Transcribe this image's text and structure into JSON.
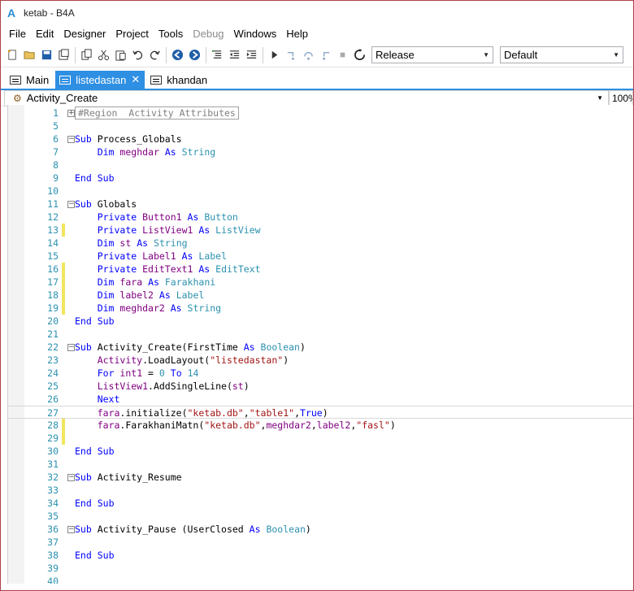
{
  "window": {
    "title": "ketab - B4A"
  },
  "menu": [
    "File",
    "Edit",
    "Designer",
    "Project",
    "Tools",
    "Debug",
    "Windows",
    "Help"
  ],
  "toolbar": {
    "build_config": "Release",
    "device_config": "Default"
  },
  "tabs": [
    {
      "label": "Main",
      "active": false
    },
    {
      "label": "listedastan",
      "active": true,
      "close": "✕"
    },
    {
      "label": "khandan",
      "active": false
    }
  ],
  "subbar": {
    "module": "Activity_Create",
    "zoom": "100%"
  },
  "code_lines": [
    {
      "n": "1",
      "t": "#Region  Activity Attributes"
    },
    {
      "n": "5",
      "t": ""
    },
    {
      "n": "6",
      "t": "Sub Process_Globals"
    },
    {
      "n": "7",
      "t": "    Dim meghdar As String"
    },
    {
      "n": "8",
      "t": ""
    },
    {
      "n": "9",
      "t": "End Sub"
    },
    {
      "n": "10",
      "t": ""
    },
    {
      "n": "11",
      "t": "Sub Globals"
    },
    {
      "n": "12",
      "t": "    Private Button1 As Button"
    },
    {
      "n": "13",
      "t": "    Private ListView1 As ListView"
    },
    {
      "n": "14",
      "t": "    Dim st As String"
    },
    {
      "n": "15",
      "t": "    Private Label1 As Label"
    },
    {
      "n": "16",
      "t": "    Private EditText1 As EditText"
    },
    {
      "n": "17",
      "t": "    Dim fara As Farakhani"
    },
    {
      "n": "18",
      "t": "    Dim label2 As Label"
    },
    {
      "n": "19",
      "t": "    Dim meghdar2 As String"
    },
    {
      "n": "20",
      "t": "End Sub"
    },
    {
      "n": "21",
      "t": ""
    },
    {
      "n": "22",
      "t": "Sub Activity_Create(FirstTime As Boolean)"
    },
    {
      "n": "23",
      "t": "    Activity.LoadLayout(\"listedastan\")"
    },
    {
      "n": "24",
      "t": "    For int1 = 0 To 14"
    },
    {
      "n": "25",
      "t": "    ListView1.AddSingleLine(st)"
    },
    {
      "n": "26",
      "t": "    Next"
    },
    {
      "n": "27",
      "t": "    fara.initialize(\"ketab.db\",\"table1\",True)"
    },
    {
      "n": "28",
      "t": "    fara.FarakhaniMatn(\"ketab.db\",meghdar2,label2,\"fasl\")"
    },
    {
      "n": "29",
      "t": ""
    },
    {
      "n": "30",
      "t": "End Sub"
    },
    {
      "n": "31",
      "t": ""
    },
    {
      "n": "32",
      "t": "Sub Activity_Resume"
    },
    {
      "n": "33",
      "t": ""
    },
    {
      "n": "34",
      "t": "End Sub"
    },
    {
      "n": "35",
      "t": ""
    },
    {
      "n": "36",
      "t": "Sub Activity_Pause (UserClosed As Boolean)"
    },
    {
      "n": "37",
      "t": ""
    },
    {
      "n": "38",
      "t": "End Sub"
    },
    {
      "n": "39",
      "t": ""
    },
    {
      "n": "40",
      "t": ""
    }
  ],
  "colors": {
    "accent": "#2e8fe3",
    "keyword": "#0000ff",
    "type": "#2b91af",
    "string": "#a31515",
    "modified_marker": "#f1e65d"
  }
}
